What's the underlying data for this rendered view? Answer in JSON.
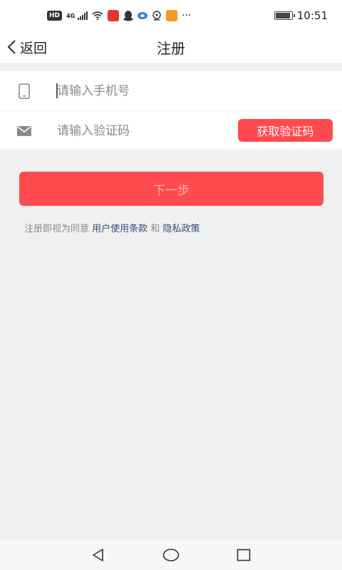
{
  "status_bar": {
    "hd": "HD",
    "network": "4G",
    "time": "10:51",
    "battery_level": 0.92,
    "more": "···",
    "icons": [
      "signal-icon",
      "wifi-icon",
      "app-icon-red",
      "qq-penguin-icon",
      "app-icon-blue",
      "location-icon",
      "app-icon-orange",
      "more-dots-icon",
      "battery-icon"
    ]
  },
  "nav": {
    "back_label": "返回",
    "title": "注册"
  },
  "form": {
    "phone_placeholder": "请输入手机号",
    "code_placeholder": "请输入验证码",
    "get_code_label": "获取验证码"
  },
  "next_label": "下一步",
  "agreement": {
    "prefix": "注册即视为同意",
    "terms": "用户使用条款",
    "and": "和",
    "privacy": "隐私政策"
  },
  "colors": {
    "accent": "#ff4b4f",
    "link": "#3a4a7a",
    "background": "#f0f0f0"
  }
}
